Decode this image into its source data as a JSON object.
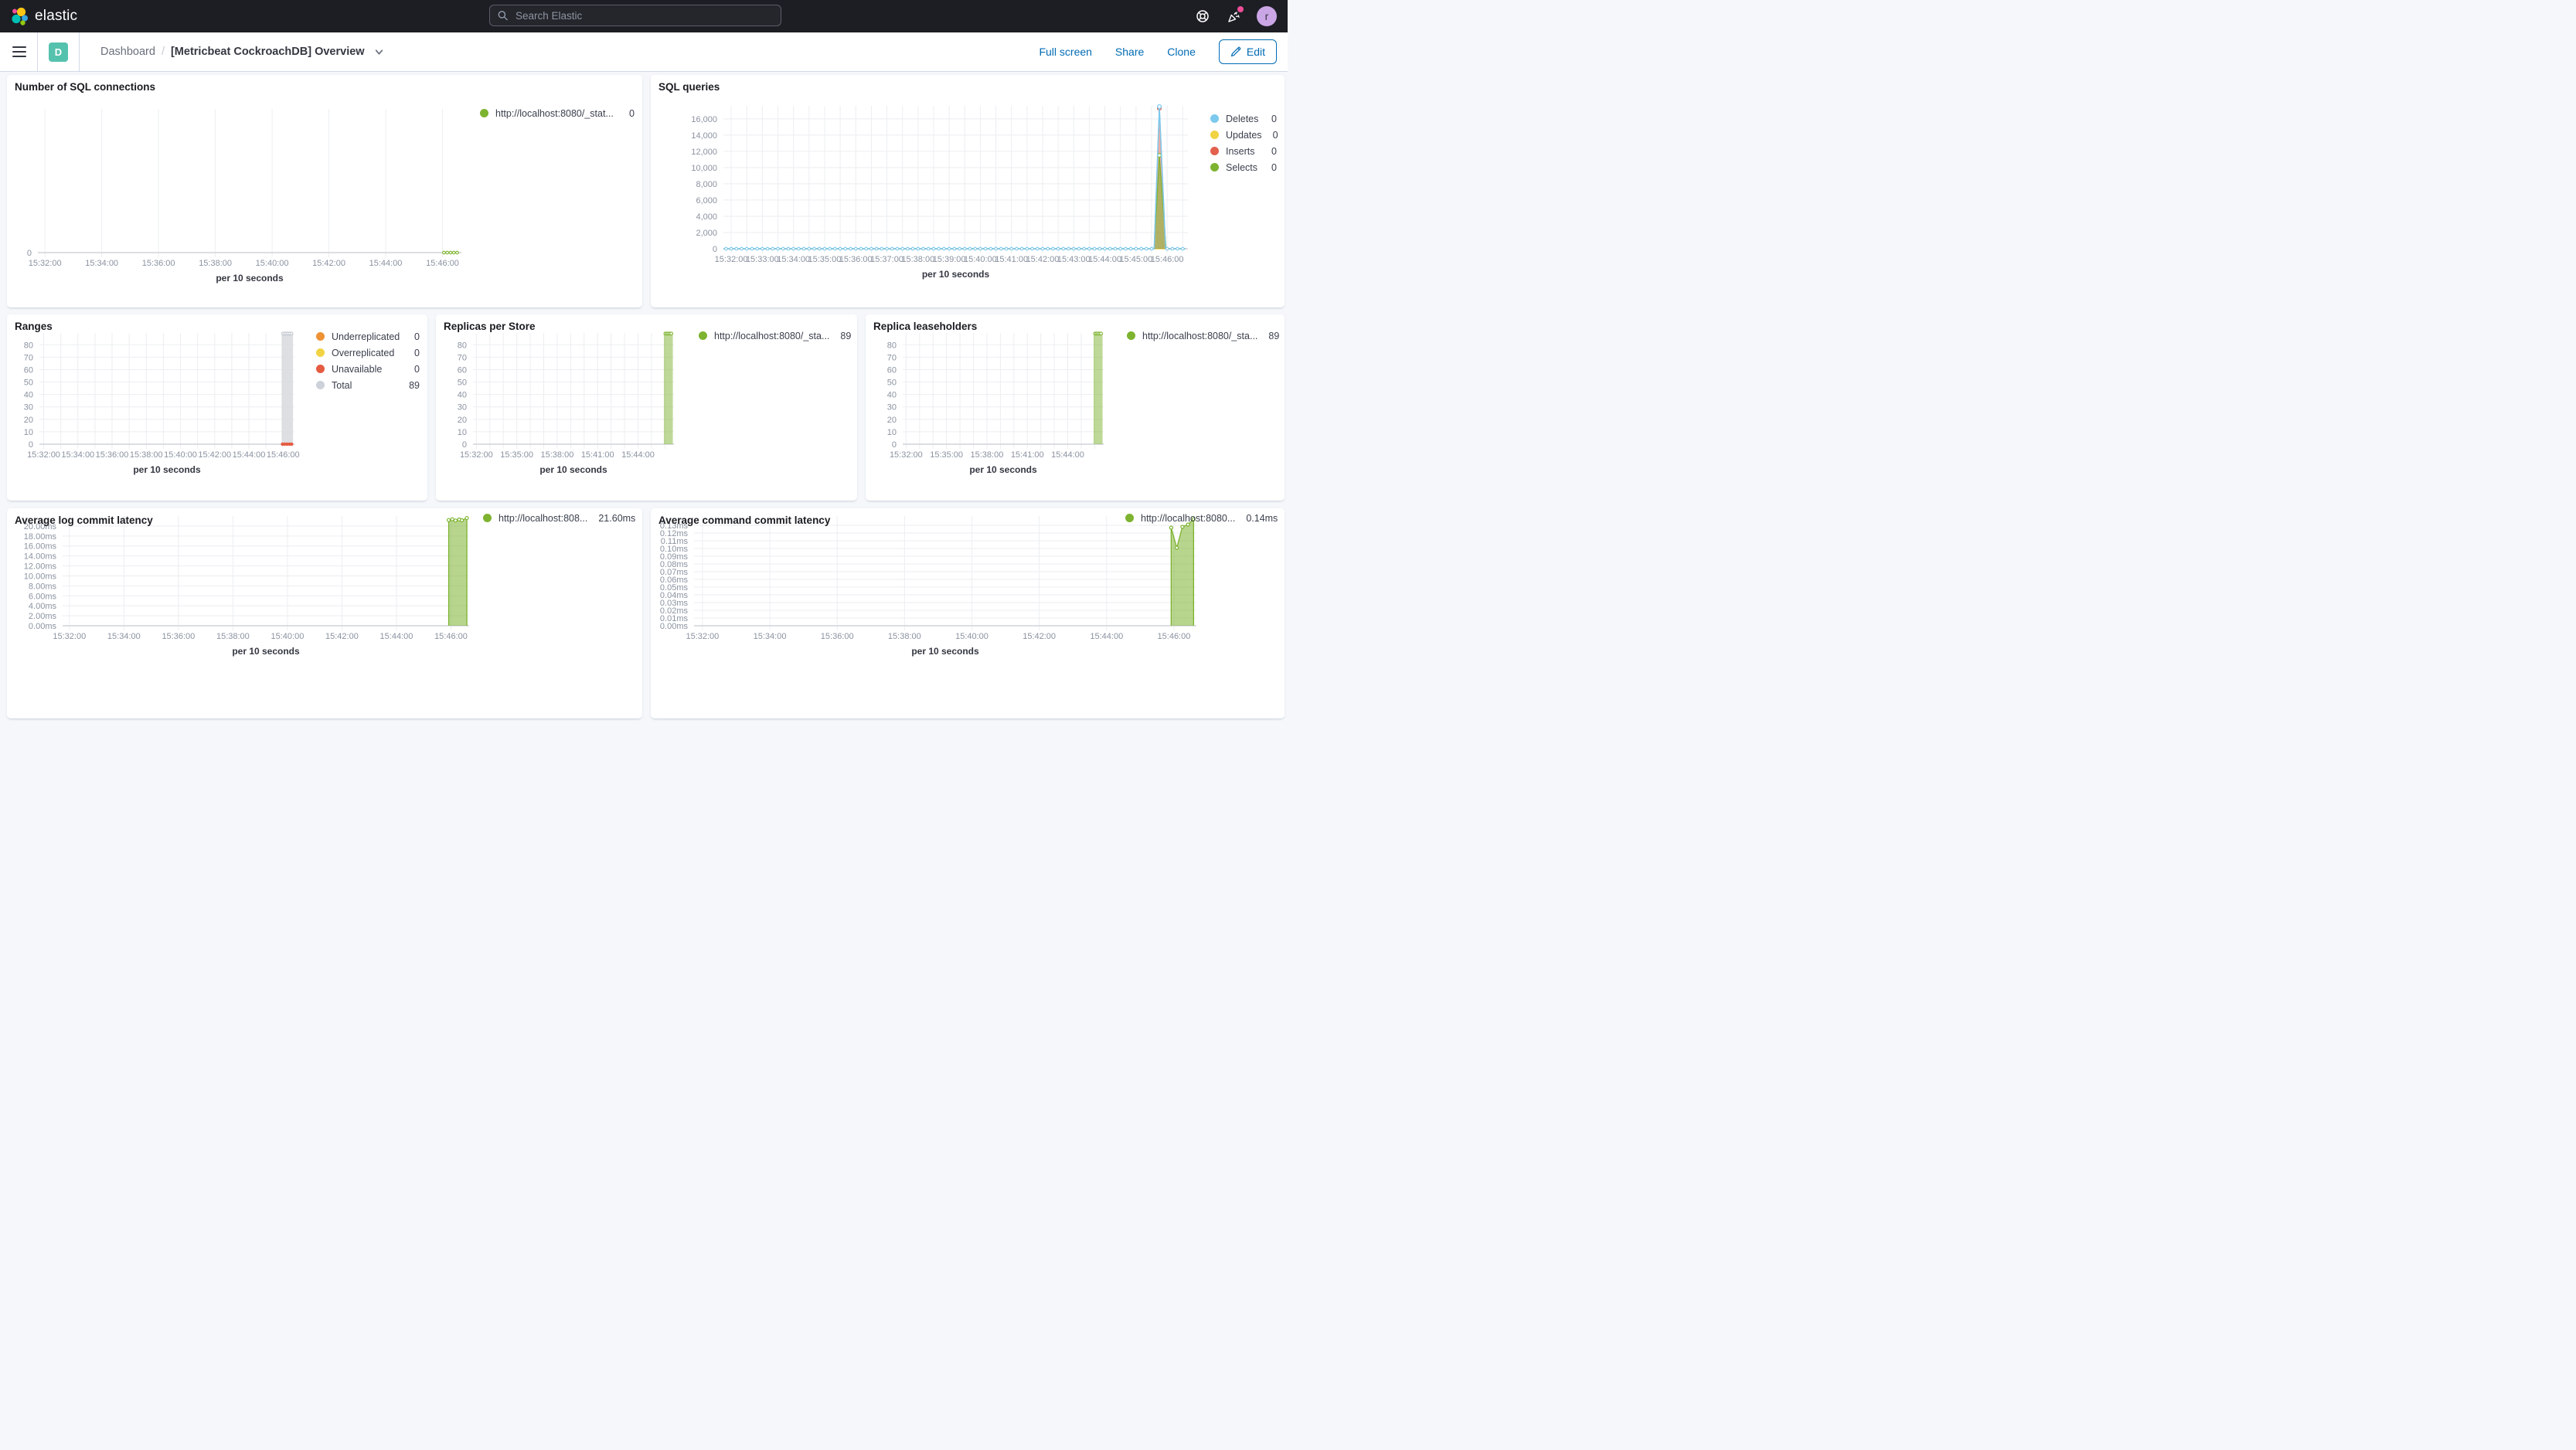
{
  "header": {
    "logo_text": "elastic",
    "search": {
      "placeholder": "Search Elastic"
    },
    "icons": [
      "help-icon",
      "news-icon"
    ],
    "notification_dot_color": "#F04E98",
    "avatar": {
      "initial": "r",
      "color": "#CBA6E6"
    }
  },
  "breadcrumb": {
    "badge": {
      "letter": "D",
      "color": "#55C2AE"
    },
    "root": "Dashboard",
    "separator": "/",
    "current": "[Metricbeat CockroachDB] Overview"
  },
  "actions": {
    "full_screen": "Full screen",
    "share": "Share",
    "clone": "Clone",
    "edit": "Edit"
  },
  "panels": [
    {
      "title": "Number of SQL connections",
      "legend_pos": {
        "left": 612,
        "top": 39
      },
      "legend": [
        {
          "color": "#7DB32F",
          "label": "http://localhost:8080/_stat...",
          "value": "0"
        }
      ]
    },
    {
      "title": "SQL queries",
      "legend_pos": {
        "left": 724,
        "top": 46
      },
      "legend": [
        {
          "color": "#7CC9EE",
          "label": "Deletes",
          "value": "0"
        },
        {
          "color": "#F1D343",
          "label": "Updates",
          "value": "0"
        },
        {
          "color": "#E2604D",
          "label": "Inserts",
          "value": "0"
        },
        {
          "color": "#7DB32F",
          "label": "Selects",
          "value": "0"
        }
      ]
    },
    {
      "title": "Ranges",
      "legend_pos": {
        "left": 400,
        "top": 18
      },
      "legend": [
        {
          "color": "#EE9234",
          "label": "Underreplicated",
          "value": "0"
        },
        {
          "color": "#F1D343",
          "label": "Overreplicated",
          "value": "0"
        },
        {
          "color": "#E55B41",
          "label": "Unavailable",
          "value": "0"
        },
        {
          "color": "#CDD1D9",
          "label": "Total",
          "value": "89"
        }
      ]
    },
    {
      "title": "Replicas per Store",
      "legend_pos": {
        "left": 340,
        "top": 17
      },
      "legend": [
        {
          "color": "#7DB32F",
          "label": "http://localhost:8080/_sta...",
          "value": "89"
        }
      ]
    },
    {
      "title": "Replica leaseholders",
      "legend_pos": {
        "left": 338,
        "top": 17
      },
      "legend": [
        {
          "color": "#7DB32F",
          "label": "http://localhost:8080/_sta...",
          "value": "89"
        }
      ]
    },
    {
      "title": "Average log commit latency",
      "legend_pos": {
        "left": 616,
        "top": 2
      },
      "legend": [
        {
          "color": "#7DB32F",
          "label": "http://localhost:808...",
          "value": "21.60ms"
        }
      ]
    },
    {
      "title": "Average command commit latency",
      "legend_pos": {
        "left": 614,
        "top": 2
      },
      "legend": [
        {
          "color": "#7DB32F",
          "label": "http://localhost:8080...",
          "value": "0.14ms"
        }
      ]
    }
  ],
  "chart_data": [
    {
      "type": "line",
      "title": "Number of SQL connections",
      "xlabel": "per 10 seconds",
      "x_domain": [
        "15:31:45",
        "15:46:40"
      ],
      "grid_s": 120,
      "x_ticks": [
        "15:32:00",
        "15:34:00",
        "15:36:00",
        "15:38:00",
        "15:40:00",
        "15:42:00",
        "15:44:00",
        "15:46:00"
      ],
      "y": {
        "min": 0,
        "max": 1
      },
      "y_ticks": [
        {
          "v": 0,
          "label": "0"
        }
      ],
      "layout": {
        "l": 40,
        "t": 44,
        "r": 588,
        "b": 230
      },
      "series": [
        {
          "name": "http://localhost:8080/_stat...",
          "type": "line",
          "color": "#7DB32F",
          "width": 1.4,
          "dash": "3,4",
          "markers_every": 7,
          "points": [
            [
              "15:46:00",
              0
            ],
            [
              "15:46:35",
              0
            ]
          ]
        }
      ]
    },
    {
      "type": "area",
      "title": "SQL queries",
      "xlabel": "per 10 seconds",
      "x_domain": [
        "15:31:45",
        "15:46:40"
      ],
      "grid_s": 30,
      "x_ticks": [
        "15:32:00",
        "15:33:00",
        "15:34:00",
        "15:35:00",
        "15:36:00",
        "15:37:00",
        "15:38:00",
        "15:39:00",
        "15:40:00",
        "15:41:00",
        "15:42:00",
        "15:43:00",
        "15:44:00",
        "15:45:00",
        "15:46:00"
      ],
      "y": {
        "min": 0,
        "max": 17600
      },
      "y_ticks": [
        {
          "v": 0,
          "label": "0"
        },
        {
          "v": 2000,
          "label": "2,000"
        },
        {
          "v": 4000,
          "label": "4,000"
        },
        {
          "v": 6000,
          "label": "6,000"
        },
        {
          "v": 8000,
          "label": "8,000"
        },
        {
          "v": 10000,
          "label": "10,000"
        },
        {
          "v": 12000,
          "label": "12,000"
        },
        {
          "v": 14000,
          "label": "14,000"
        },
        {
          "v": 16000,
          "label": "16,000"
        }
      ],
      "layout": {
        "l": 94,
        "t": 40,
        "r": 695,
        "b": 225
      },
      "series": [
        {
          "name": "Updates",
          "type": "line",
          "color": "#F1D343",
          "width": 1.2,
          "points": [
            [
              "15:31:45",
              0
            ],
            [
              "15:46:35",
              0
            ]
          ]
        },
        {
          "name": "Inserts",
          "type": "area",
          "color": "#E2604D",
          "fill_opacity": 0.5,
          "width": 1.2,
          "points": [
            [
              "15:31:45",
              0
            ],
            [
              "15:45:35",
              0
            ],
            [
              "15:45:45",
              17300
            ],
            [
              "15:45:57",
              0
            ],
            [
              "15:46:35",
              0
            ]
          ],
          "point_markers": [
            [
              "15:45:45",
              17300
            ]
          ]
        },
        {
          "name": "Selects",
          "type": "area",
          "color": "#7DB32F",
          "fill_opacity": 0.55,
          "width": 1.2,
          "points": [
            [
              "15:31:45",
              0
            ],
            [
              "15:45:35",
              0
            ],
            [
              "15:45:45",
              11500
            ],
            [
              "15:45:58",
              0
            ],
            [
              "15:46:35",
              0
            ]
          ],
          "point_markers": [
            [
              "15:45:45",
              11500
            ]
          ]
        },
        {
          "name": "Deletes",
          "type": "line",
          "color": "#7CC9EE",
          "width": 1.5,
          "markers_every": 10,
          "points": [
            [
              "15:31:45",
              0
            ],
            [
              "15:45:35",
              0
            ],
            [
              "15:45:45",
              17500
            ],
            [
              "15:45:57",
              0
            ],
            [
              "15:46:35",
              0
            ]
          ],
          "point_markers": [
            [
              "15:45:45",
              17500
            ]
          ]
        }
      ]
    },
    {
      "type": "bar",
      "title": "Ranges",
      "xlabel": "per 10 seconds",
      "x_domain": [
        "15:31:45",
        "15:46:40"
      ],
      "grid_s": 60,
      "x_ticks": [
        "15:32:00",
        "15:34:00",
        "15:36:00",
        "15:38:00",
        "15:40:00",
        "15:42:00",
        "15:44:00",
        "15:46:00"
      ],
      "y": {
        "min": 0,
        "max": 89.5
      },
      "y_ticks": [
        {
          "v": 0,
          "label": "0"
        },
        {
          "v": 10,
          "label": "10"
        },
        {
          "v": 20,
          "label": "20"
        },
        {
          "v": 30,
          "label": "30"
        },
        {
          "v": 40,
          "label": "40"
        },
        {
          "v": 50,
          "label": "50"
        },
        {
          "v": 60,
          "label": "60"
        },
        {
          "v": 70,
          "label": "70"
        },
        {
          "v": 80,
          "label": "80"
        }
      ],
      "layout": {
        "l": 42,
        "t": 24,
        "r": 372,
        "b": 168
      },
      "series": [
        {
          "name": "Total",
          "type": "bar",
          "color": "#D9DBDF",
          "fill_opacity": 0.9,
          "bar": {
            "from": "15:45:55",
            "to": "15:46:35",
            "value": 89
          },
          "top_markers": {
            "n": 5,
            "stroke": "#BEC3CC"
          }
        },
        {
          "name": "Unavailable",
          "type": "dots",
          "color": "#E55B41",
          "points": [
            [
              "15:45:58",
              0
            ],
            [
              "15:46:06",
              0
            ],
            [
              "15:46:14",
              0
            ],
            [
              "15:46:22",
              0
            ],
            [
              "15:46:30",
              0
            ]
          ]
        }
      ]
    },
    {
      "type": "bar",
      "title": "Replicas per Store",
      "xlabel": "per 10 seconds",
      "x_domain": [
        "15:31:45",
        "15:46:40"
      ],
      "grid_s": 60,
      "x_ticks": [
        "15:32:00",
        "15:35:00",
        "15:38:00",
        "15:41:00",
        "15:44:00"
      ],
      "y": {
        "min": 0,
        "max": 89.5
      },
      "y_ticks": [
        {
          "v": 0,
          "label": "0"
        },
        {
          "v": 10,
          "label": "10"
        },
        {
          "v": 20,
          "label": "20"
        },
        {
          "v": 30,
          "label": "30"
        },
        {
          "v": 40,
          "label": "40"
        },
        {
          "v": 50,
          "label": "50"
        },
        {
          "v": 60,
          "label": "60"
        },
        {
          "v": 70,
          "label": "70"
        },
        {
          "v": 80,
          "label": "80"
        }
      ],
      "layout": {
        "l": 48,
        "t": 24,
        "r": 308,
        "b": 168
      },
      "series": [
        {
          "name": "http://localhost:8080/_sta...",
          "type": "bar",
          "color": "#7DB32F",
          "fill_opacity": 0.5,
          "bar": {
            "from": "15:45:55",
            "to": "15:46:35",
            "value": 89
          },
          "top_markers": {
            "n": 5,
            "stroke": "#7DB32F"
          }
        }
      ]
    },
    {
      "type": "bar",
      "title": "Replica leaseholders",
      "xlabel": "per 10 seconds",
      "x_domain": [
        "15:31:45",
        "15:46:40"
      ],
      "grid_s": 60,
      "x_ticks": [
        "15:32:00",
        "15:35:00",
        "15:38:00",
        "15:41:00",
        "15:44:00"
      ],
      "y": {
        "min": 0,
        "max": 89.5
      },
      "y_ticks": [
        {
          "v": 0,
          "label": "0"
        },
        {
          "v": 10,
          "label": "10"
        },
        {
          "v": 20,
          "label": "20"
        },
        {
          "v": 30,
          "label": "30"
        },
        {
          "v": 40,
          "label": "40"
        },
        {
          "v": 50,
          "label": "50"
        },
        {
          "v": 60,
          "label": "60"
        },
        {
          "v": 70,
          "label": "70"
        },
        {
          "v": 80,
          "label": "80"
        }
      ],
      "layout": {
        "l": 48,
        "t": 24,
        "r": 308,
        "b": 168
      },
      "series": [
        {
          "name": "http://localhost:8080/_sta...",
          "type": "bar",
          "color": "#7DB32F",
          "fill_opacity": 0.5,
          "bar": {
            "from": "15:45:55",
            "to": "15:46:35",
            "value": 89
          },
          "top_markers": {
            "n": 5,
            "stroke": "#7DB32F"
          }
        }
      ]
    },
    {
      "type": "area",
      "title": "Average log commit latency",
      "xlabel": "per 10 seconds",
      "x_domain": [
        "15:31:45",
        "15:46:40"
      ],
      "grid_s": 120,
      "x_ticks": [
        "15:32:00",
        "15:34:00",
        "15:36:00",
        "15:38:00",
        "15:40:00",
        "15:42:00",
        "15:44:00",
        "15:46:00"
      ],
      "y": {
        "min": 0,
        "max": 22
      },
      "y_ticks": [
        {
          "v": 0,
          "label": "0.00ms"
        },
        {
          "v": 2,
          "label": "2.00ms"
        },
        {
          "v": 4,
          "label": "4.00ms"
        },
        {
          "v": 6,
          "label": "6.00ms"
        },
        {
          "v": 8,
          "label": "8.00ms"
        },
        {
          "v": 10,
          "label": "10.00ms"
        },
        {
          "v": 12,
          "label": "12.00ms"
        },
        {
          "v": 14,
          "label": "14.00ms"
        },
        {
          "v": 16,
          "label": "16.00ms"
        },
        {
          "v": 18,
          "label": "18.00ms"
        },
        {
          "v": 20,
          "label": "20.00ms"
        }
      ],
      "layout": {
        "l": 72,
        "t": 10,
        "r": 598,
        "b": 152
      },
      "series": [
        {
          "name": "http://localhost:808...",
          "type": "area",
          "color": "#7DB32F",
          "fill_opacity": 0.55,
          "width": 1.3,
          "markers": true,
          "points": [
            [
              "15:45:55",
              21.2
            ],
            [
              "15:46:03",
              21.35
            ],
            [
              "15:46:10",
              21.1
            ],
            [
              "15:46:18",
              21.3
            ],
            [
              "15:46:24",
              21.15
            ],
            [
              "15:46:35",
              21.6
            ]
          ]
        }
      ]
    },
    {
      "type": "area",
      "title": "Average command commit latency",
      "xlabel": "per 10 seconds",
      "x_domain": [
        "15:31:45",
        "15:46:40"
      ],
      "grid_s": 120,
      "x_ticks": [
        "15:32:00",
        "15:34:00",
        "15:36:00",
        "15:38:00",
        "15:40:00",
        "15:42:00",
        "15:44:00",
        "15:46:00"
      ],
      "y": {
        "min": 0,
        "max": 0.142
      },
      "y_ticks": [
        {
          "v": 0,
          "label": "0.00ms"
        },
        {
          "v": 0.01,
          "label": "0.01ms"
        },
        {
          "v": 0.02,
          "label": "0.02ms"
        },
        {
          "v": 0.03,
          "label": "0.03ms"
        },
        {
          "v": 0.04,
          "label": "0.04ms"
        },
        {
          "v": 0.05,
          "label": "0.05ms"
        },
        {
          "v": 0.06,
          "label": "0.06ms"
        },
        {
          "v": 0.07,
          "label": "0.07ms"
        },
        {
          "v": 0.08,
          "label": "0.08ms"
        },
        {
          "v": 0.09,
          "label": "0.09ms"
        },
        {
          "v": 0.1,
          "label": "0.10ms"
        },
        {
          "v": 0.11,
          "label": "0.11ms"
        },
        {
          "v": 0.12,
          "label": "0.12ms"
        },
        {
          "v": 0.13,
          "label": "0.13ms"
        }
      ],
      "layout": {
        "l": 56,
        "t": 10,
        "r": 706,
        "b": 152
      },
      "series": [
        {
          "name": "http://localhost:8080...",
          "type": "area",
          "color": "#7DB32F",
          "fill_opacity": 0.55,
          "width": 1.3,
          "markers": true,
          "points": [
            [
              "15:45:55",
              0.127
            ],
            [
              "15:46:05",
              0.101
            ],
            [
              "15:46:15",
              0.128
            ],
            [
              "15:46:25",
              0.131
            ],
            [
              "15:46:35",
              0.138
            ]
          ]
        }
      ]
    }
  ]
}
